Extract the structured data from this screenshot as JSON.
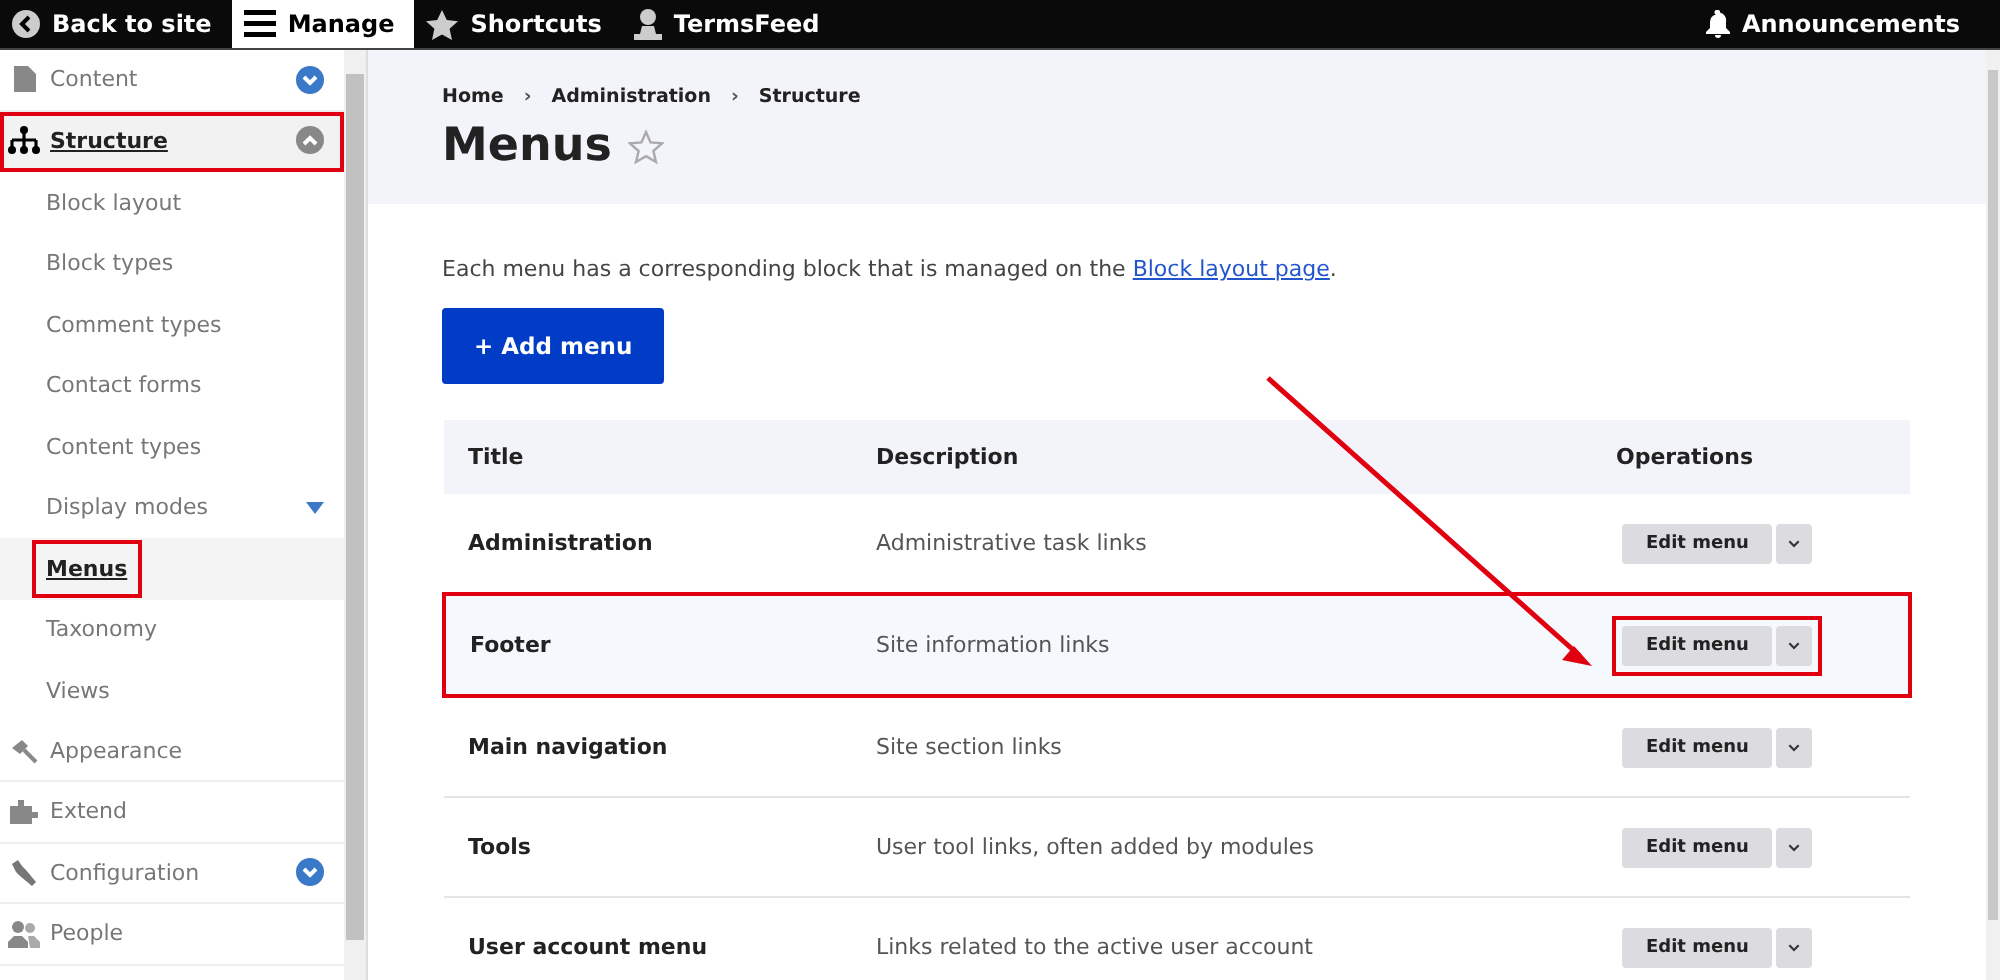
{
  "toolbar": {
    "items": [
      {
        "label": "Back to site",
        "selected": false
      },
      {
        "label": "Manage",
        "selected": true
      },
      {
        "label": "Shortcuts",
        "selected": false
      },
      {
        "label": "TermsFeed",
        "selected": false
      }
    ],
    "announcements": "Announcements"
  },
  "sidebar": {
    "items": [
      {
        "label": "Content",
        "selected": false,
        "highlighted": false,
        "expanded": false
      },
      {
        "label": "Structure",
        "selected": true,
        "highlighted": true,
        "expanded": true,
        "children": [
          {
            "label": "Block layout",
            "selected": false,
            "highlighted": false
          },
          {
            "label": "Block types",
            "selected": false,
            "highlighted": false
          },
          {
            "label": "Comment types",
            "selected": false,
            "highlighted": false
          },
          {
            "label": "Contact forms",
            "selected": false,
            "highlighted": false
          },
          {
            "label": "Content types",
            "selected": false,
            "highlighted": false
          },
          {
            "label": "Display modes",
            "selected": false,
            "highlighted": false,
            "expanded": false
          },
          {
            "label": "Menus",
            "selected": true,
            "highlighted": true
          },
          {
            "label": "Taxonomy",
            "selected": false,
            "highlighted": false
          },
          {
            "label": "Views",
            "selected": false,
            "highlighted": false
          }
        ]
      },
      {
        "label": "Appearance",
        "selected": false,
        "highlighted": false
      },
      {
        "label": "Extend",
        "selected": false,
        "highlighted": false
      },
      {
        "label": "Configuration",
        "selected": false,
        "highlighted": false,
        "expanded": false
      },
      {
        "label": "People",
        "selected": false,
        "highlighted": false
      }
    ]
  },
  "breadcrumb": {
    "items": [
      "Home",
      "Administration",
      "Structure"
    ],
    "separator": "›"
  },
  "page_title": "Menus",
  "intro": {
    "text": "Each menu has a corresponding block that is managed on the ",
    "link": "Block layout page",
    "end": "."
  },
  "add_button": "+ Add menu",
  "table": {
    "columns": [
      "Title",
      "Description",
      "Operations"
    ],
    "rows": [
      {
        "title": "Administration",
        "description": "Administrative task links",
        "operation": "Edit menu",
        "highlighted": false
      },
      {
        "title": "Footer",
        "description": "Site information links",
        "operation": "Edit menu",
        "highlighted": true
      },
      {
        "title": "Main navigation",
        "description": "Site section links",
        "operation": "Edit menu",
        "highlighted": false
      },
      {
        "title": "Tools",
        "description": "User tool links, often added by modules",
        "operation": "Edit menu",
        "highlighted": false
      },
      {
        "title": "User account menu",
        "description": "Links related to the active user account",
        "operation": "Edit menu",
        "highlighted": false
      }
    ]
  }
}
